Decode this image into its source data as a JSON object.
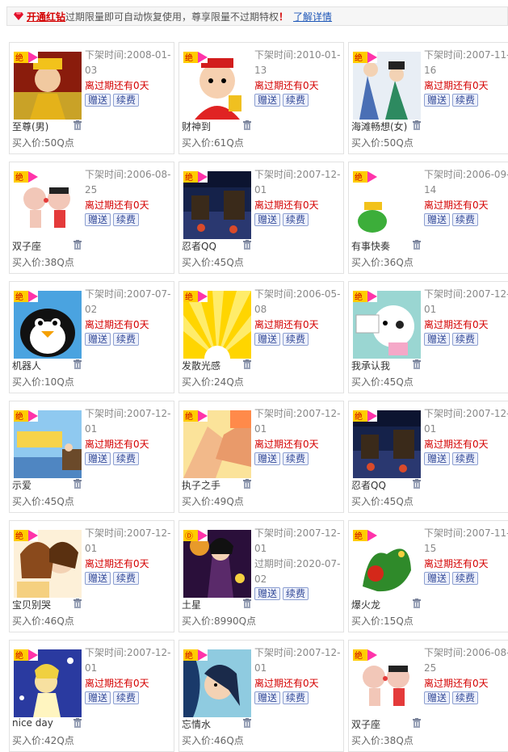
{
  "notice": {
    "link": "开通红钻",
    "text": "过期限量即可自动恢复使用，尊享限量不过期特权",
    "excl": "！",
    "more": "了解详情"
  },
  "labels": {
    "gift": "赠送",
    "renew": "续费"
  },
  "colors": {
    "expire_red": "#d40000",
    "link_blue": "#1d56b8",
    "badge_yellow": "#ffcc00",
    "badge_pink": "#ff33aa"
  },
  "items": [
    {
      "name": "至尊(男)",
      "date": "下架时间:2008-01-03",
      "expire": "离过期还有0天",
      "price": "买入价:50Q点",
      "badge": "绝",
      "theme": "emperor"
    },
    {
      "name": "财神到",
      "date": "下架时间:2010-01-13",
      "expire": "离过期还有0天",
      "price": "买入价:61Q点",
      "badge": "绝",
      "theme": "fortune"
    },
    {
      "name": "海滩畅想(女)",
      "date": "下架时间:2007-11-16",
      "expire": "离过期还有0天",
      "price": "买入价:50Q点",
      "badge": "绝",
      "theme": "beach"
    },
    {
      "name": "双子座",
      "date": "下架时间:2006-08-25",
      "expire": "离过期还有0天",
      "price": "买入价:38Q点",
      "badge": "绝",
      "theme": "twins"
    },
    {
      "name": "忍者QQ",
      "date": "下架时间:2007-12-01",
      "expire": "离过期还有0天",
      "price": "买入价:45Q点",
      "badge": "绝",
      "theme": "ninja"
    },
    {
      "name": "有事快奏",
      "date": "下架时间:2006-09-14",
      "expire": "离过期还有0天",
      "price": "买入价:36Q点",
      "badge": "绝",
      "theme": "frog"
    },
    {
      "name": "机器人",
      "date": "下架时间:2007-07-02",
      "expire": "离过期还有0天",
      "price": "买入价:10Q点",
      "badge": "绝",
      "theme": "penguin"
    },
    {
      "name": "发散光感",
      "date": "下架时间:2006-05-08",
      "expire": "离过期还有0天",
      "price": "买入价:24Q点",
      "badge": "绝",
      "theme": "rays"
    },
    {
      "name": "我承认我",
      "date": "下架时间:2007-12-01",
      "expire": "离过期还有0天",
      "price": "买入价:45Q点",
      "badge": "绝",
      "theme": "dog"
    },
    {
      "name": "示爱",
      "date": "下架时间:2007-12-01",
      "expire": "离过期还有0天",
      "price": "买入价:45Q点",
      "badge": "绝",
      "theme": "loveu"
    },
    {
      "name": "执子之手",
      "date": "下架时间:2007-12-01",
      "expire": "离过期还有0天",
      "price": "买入价:49Q点",
      "badge": "绝",
      "theme": "hands"
    },
    {
      "name": "忍者QQ",
      "date": "下架时间:2007-12-01",
      "expire": "离过期还有0天",
      "price": "买入价:45Q点",
      "badge": "绝",
      "theme": "ninja"
    },
    {
      "name": "宝贝别哭",
      "date": "下架时间:2007-12-01",
      "expire": "离过期还有0天",
      "price": "买入价:46Q点",
      "badge": "绝",
      "theme": "couple"
    },
    {
      "name": "土星",
      "date": "下架时间:2007-12-01",
      "expire2": "过期时间:2020-07-02",
      "price": "买入价:8990Q点",
      "badge": "Ⓓ",
      "theme": "saturn"
    },
    {
      "name": "爆火龙",
      "date": "下架时间:2007-11-15",
      "expire": "离过期还有0天",
      "price": "买入价:15Q点",
      "badge": "绝",
      "theme": "dragon"
    },
    {
      "name": "nice day",
      "date": "下架时间:2007-12-01",
      "expire": "离过期还有0天",
      "price": "买入价:42Q点",
      "badge": "绝",
      "theme": "niceday"
    },
    {
      "name": "忘情水",
      "date": "下架时间:2007-12-01",
      "expire": "离过期还有0天",
      "price": "买入价:46Q点",
      "badge": "绝",
      "theme": "water"
    },
    {
      "name": "双子座",
      "date": "下架时间:2006-08-25",
      "expire": "离过期还有0天",
      "price": "买入价:38Q点",
      "badge": "绝",
      "theme": "twins"
    }
  ]
}
